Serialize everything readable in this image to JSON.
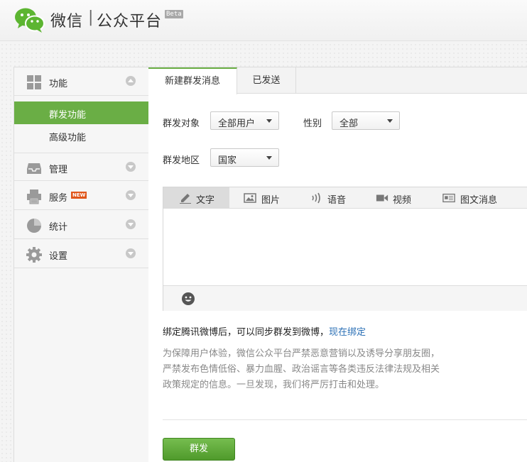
{
  "header": {
    "brand": "微信",
    "separator": "|",
    "subtitle": "公众平台",
    "badge": "Beta"
  },
  "sidebar": {
    "items": [
      {
        "label": "功能",
        "icon": "grid-icon",
        "expanded": true
      },
      {
        "label": "管理",
        "icon": "inbox-icon"
      },
      {
        "label": "服务",
        "icon": "printer-icon",
        "badge": "NEW"
      },
      {
        "label": "统计",
        "icon": "pie-chart-icon"
      },
      {
        "label": "设置",
        "icon": "gear-icon"
      }
    ],
    "sub_items": [
      {
        "label": "群发功能",
        "active": true
      },
      {
        "label": "高级功能"
      }
    ]
  },
  "main": {
    "tabs": [
      {
        "label": "新建群发消息",
        "active": true
      },
      {
        "label": "已发送"
      }
    ],
    "filters": {
      "target_label": "群发对象",
      "target_value": "全部用户",
      "gender_label": "性别",
      "gender_value": "全部",
      "region_label": "群发地区",
      "region_value": "国家"
    },
    "editor": {
      "tabs": [
        {
          "label": "文字",
          "icon": "pencil-icon",
          "active": true
        },
        {
          "label": "图片",
          "icon": "image-icon"
        },
        {
          "label": "语音",
          "icon": "audio-icon"
        },
        {
          "label": "视频",
          "icon": "video-icon"
        },
        {
          "label": "图文消息",
          "icon": "article-icon"
        }
      ],
      "content": ""
    },
    "bind_text": "绑定腾讯微博后，可以同步群发到微博，",
    "bind_link": "现在绑定",
    "notice_lines": [
      "为保障用户体验，微信公众平台严禁恶意营销以及诱导分享朋友圈，",
      "严禁发布色情低俗、暴力血腥、政治谣言等各类违反法律法规及相关",
      "政策规定的信息。一旦发现，我们将严厉打击和处理。"
    ],
    "send_button": "群发"
  },
  "colors": {
    "accent": "#6aae45",
    "link": "#2a6fb5",
    "badge_new": "#e0561b"
  }
}
